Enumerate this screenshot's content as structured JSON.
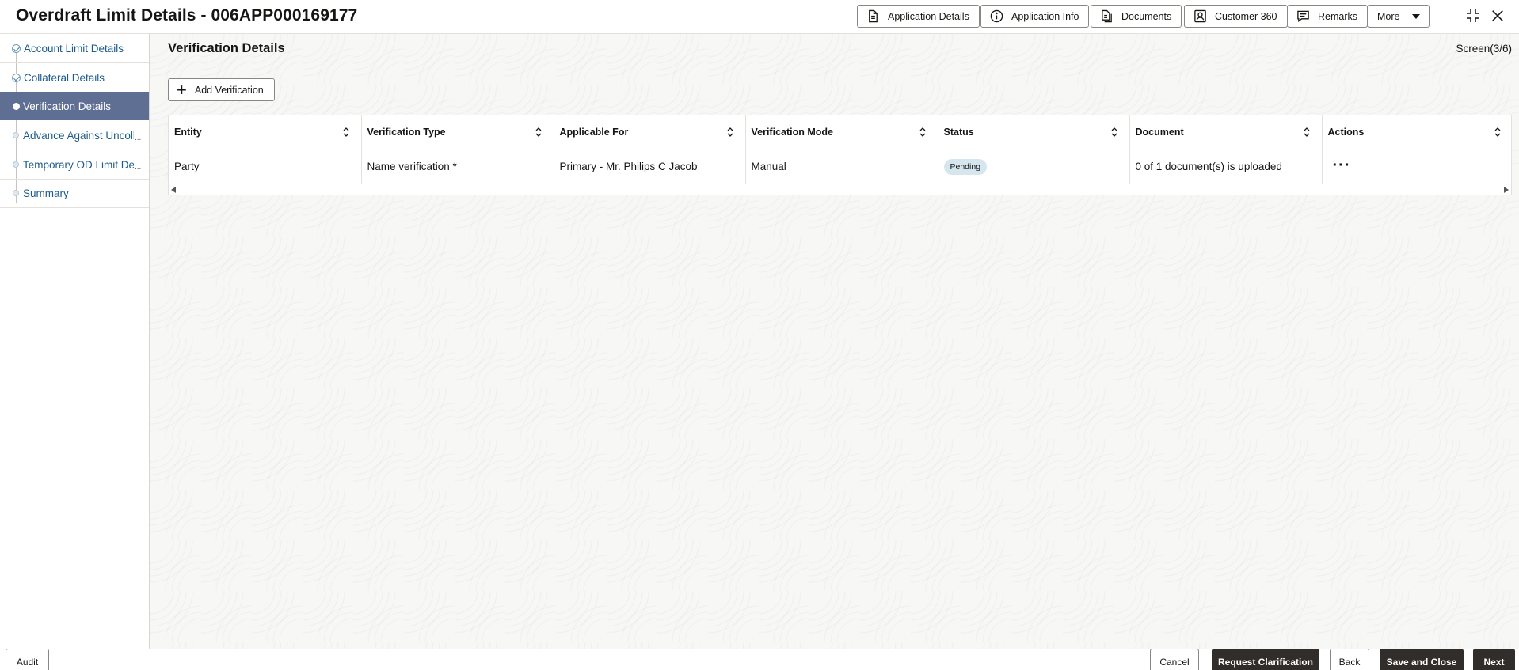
{
  "header": {
    "title": "Overdraft Limit Details - 006APP000169177",
    "buttons": {
      "application_details": "Application Details",
      "application_info": "Application Info",
      "documents": "Documents",
      "customer_360": "Customer 360",
      "remarks": "Remarks",
      "more": "More"
    }
  },
  "sidebar": {
    "steps": [
      {
        "label": "Account Limit Details",
        "state": "done"
      },
      {
        "label": "Collateral Details",
        "state": "done"
      },
      {
        "label": "Verification Details",
        "state": "active"
      },
      {
        "label": "Advance Against Uncoll",
        "state": "todo"
      },
      {
        "label": "Temporary OD Limit De",
        "state": "todo"
      },
      {
        "label": "Summary",
        "state": "todo"
      }
    ],
    "ellipsis": "..."
  },
  "main": {
    "section_title": "Verification Details",
    "screen_counter": "Screen(3/6)",
    "add_button_label": "Add Verification",
    "table": {
      "columns": [
        "Entity",
        "Verification Type",
        "Applicable For",
        "Verification Mode",
        "Status",
        "Document",
        "Actions"
      ],
      "rows": [
        {
          "entity": "Party",
          "verification_type": "Name verification *",
          "applicable_for": "Primary - Mr. Philips C Jacob",
          "verification_mode": "Manual",
          "status": "Pending",
          "document": "0 of 1 document(s) is uploaded",
          "actions": "···"
        }
      ]
    }
  },
  "footer": {
    "audit": "Audit",
    "cancel": "Cancel",
    "request_clarification": "Request Clarification",
    "back": "Back",
    "save_and_close": "Save and Close",
    "next": "Next"
  },
  "colors": {
    "active_step_bg": "#5f6f94",
    "link_blue": "#1b5b8c",
    "status_badge_bg": "#d6e6ee",
    "primary_button_bg": "#312d2a"
  }
}
